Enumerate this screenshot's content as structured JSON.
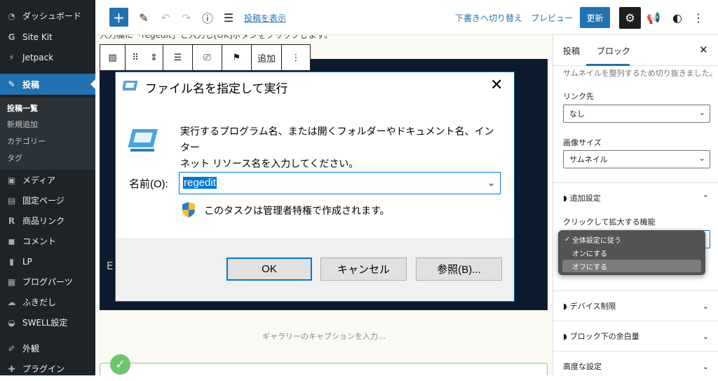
{
  "sidebar": {
    "items": [
      {
        "label": "ダッシュボード",
        "icon": "dashboard-icon"
      },
      {
        "label": "Site Kit",
        "icon": "sitekit-icon"
      },
      {
        "label": "Jetpack",
        "icon": "jetpack-icon"
      },
      {
        "label": "投稿",
        "icon": "pin-icon"
      },
      {
        "label": "メディア",
        "icon": "media-icon"
      },
      {
        "label": "固定ページ",
        "icon": "pages-icon"
      },
      {
        "label": "商品リンク",
        "icon": "rinker-icon"
      },
      {
        "label": "コメント",
        "icon": "comment-icon"
      },
      {
        "label": "LP",
        "icon": "page-icon"
      },
      {
        "label": "ブログパーツ",
        "icon": "blogparts-icon"
      },
      {
        "label": "ふきだし",
        "icon": "balloon-icon"
      },
      {
        "label": "SWELL設定",
        "icon": "swell-icon"
      },
      {
        "label": "外観",
        "icon": "brush-icon"
      },
      {
        "label": "プラグイン",
        "icon": "plugin-icon"
      }
    ],
    "submenu": [
      "投稿一覧",
      "新規追加",
      "カテゴリー",
      "タグ"
    ]
  },
  "toolbar": {
    "add_label": "+",
    "show_posts": "投稿を表示",
    "draft_switch": "下書きへ切り替え",
    "preview": "プレビュー",
    "update": "更新"
  },
  "block_toolbar": {
    "add_label": "追加"
  },
  "editor": {
    "partial_line": "入力欄に「regedit」と入力し[OK]ボタンをクリックします。",
    "gallery_caption": "ギャラリーのキャプションを入力…",
    "bg_text": "E"
  },
  "dialog": {
    "title": "ファイル名を指定して実行",
    "description_line1": "実行するプログラム名、または開くフォルダーやドキュメント名、インター",
    "description_line2": "ネット リソース名を入力してください。",
    "name_label": "名前(O):",
    "input_value": "regedit",
    "admin_note": "このタスクは管理者特権で作成されます。",
    "ok": "OK",
    "cancel": "キャンセル",
    "browse": "参照(B)..."
  },
  "panel": {
    "tab_post": "投稿",
    "tab_block": "ブロック",
    "crop_note": "サムネイルを整列するため切り抜きました。",
    "link_label": "リンク先",
    "link_value": "なし",
    "size_label": "画像サイズ",
    "size_value": "サムネイル",
    "extra_section": "追加設定",
    "zoom_label": "クリックして拡大する機能",
    "device_section": "デバイス制限",
    "margin_section": "ブロック下の余白量",
    "advanced_section": "高度な設定"
  },
  "dropdown": {
    "options": [
      "全体設定に従う",
      "オンにする",
      "オフにする"
    ],
    "selected": "全体設定に従う",
    "highlighted": "オフにする"
  },
  "colors": {
    "wp_blue": "#2271b1",
    "admin_dark": "#1d2327",
    "windows_blue": "#0078d7"
  }
}
